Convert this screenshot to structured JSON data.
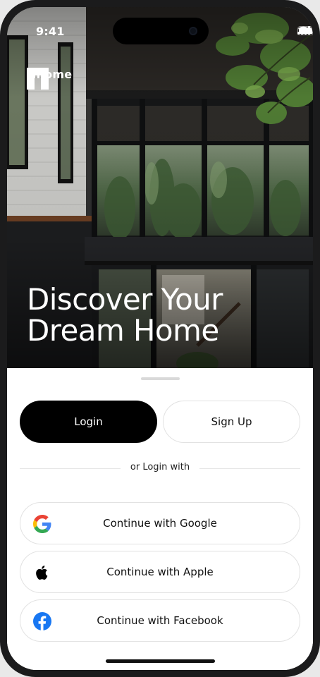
{
  "status_bar": {
    "time": "9:41"
  },
  "brand": {
    "name": "Nhome"
  },
  "hero": {
    "title_line1": "Discover Your",
    "title_line2": "Dream Home"
  },
  "auth_tabs": {
    "login_label": "Login",
    "signup_label": "Sign Up"
  },
  "divider": {
    "text": "or Login with"
  },
  "social": {
    "google_label": "Continue with Google",
    "apple_label": "Continue with Apple",
    "facebook_label": "Continue with Facebook"
  },
  "colors": {
    "primary": "#000000",
    "surface": "#ffffff",
    "border": "#e2e2e2",
    "facebook": "#1877F2",
    "google_blue": "#4285F4",
    "google_red": "#EA4335",
    "google_yellow": "#FBBC05",
    "google_green": "#34A853"
  },
  "icons": {
    "signal": "cellular-signal-icon",
    "wifi": "wifi-icon",
    "battery": "battery-icon",
    "brand": "nhome-logo",
    "google": "google-icon",
    "apple": "apple-icon",
    "facebook": "facebook-icon"
  }
}
